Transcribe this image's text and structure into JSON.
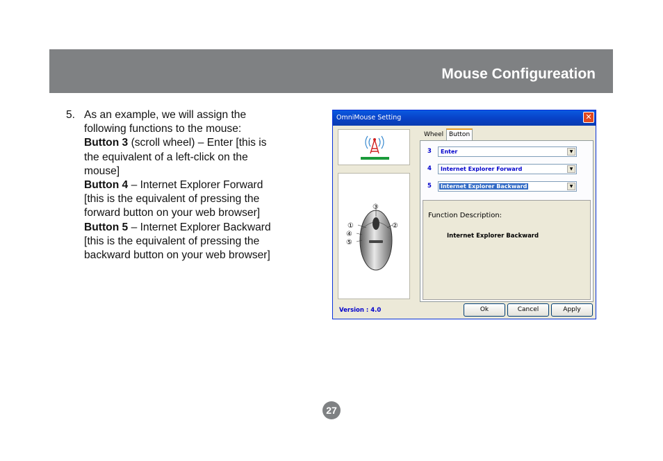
{
  "header": {
    "title": "Mouse Configureation"
  },
  "step": {
    "number": "5.",
    "intro": "As an example, we will assign the following functions to the mouse:",
    "items": [
      {
        "label": "Button 3",
        "text": " (scroll wheel) – Enter [this is the equivalent of a left-click on the mouse]"
      },
      {
        "label": "Button 4",
        "text": " – Internet Explorer Forward [this is the equivalent of pressing the forward button on your web browser]"
      },
      {
        "label": "Button 5",
        "text": " – Internet Explorer Backward [this is the equivalent of pressing the backward button on your web browser]"
      }
    ]
  },
  "dialog": {
    "title": "OmniMouse Setting",
    "close_glyph": "✕",
    "tabs": {
      "wheel": "Wheel",
      "button": "Button"
    },
    "rows": [
      {
        "label": "3",
        "value": "Enter"
      },
      {
        "label": "4",
        "value": "Internet Explorer Forward"
      },
      {
        "label": "5",
        "value": "Internet Explorer Backward"
      }
    ],
    "description_title": "Function Description:",
    "description_value": "Internet Explorer Backward",
    "version": "Version : 4.0",
    "buttons": {
      "ok": "Ok",
      "cancel": "Cancel",
      "apply": "Apply"
    },
    "mouse_callouts": [
      "③",
      "①",
      "②",
      "④",
      "⑤"
    ],
    "accent_green": "#1a9a3a",
    "accent_red": "#d02020"
  },
  "page_number": "27"
}
